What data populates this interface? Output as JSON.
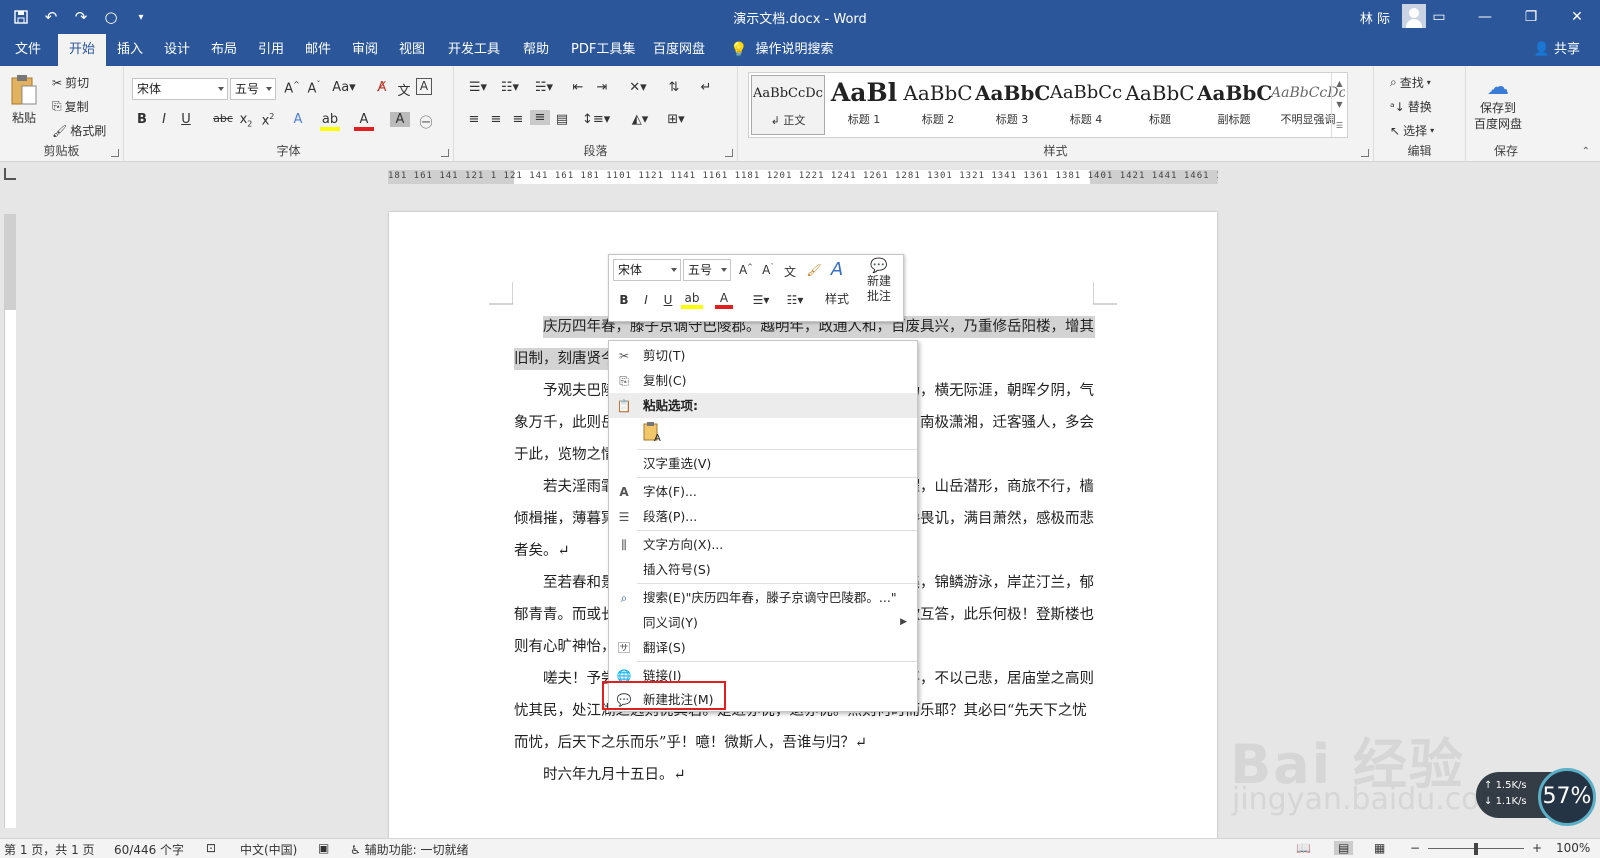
{
  "app": {
    "window_title": "演示文档.docx  -  Word",
    "user_name": "林 际",
    "share_label": "共享"
  },
  "tabs": [
    {
      "label": "文件"
    },
    {
      "label": "开始"
    },
    {
      "label": "插入"
    },
    {
      "label": "设计"
    },
    {
      "label": "布局"
    },
    {
      "label": "引用"
    },
    {
      "label": "邮件"
    },
    {
      "label": "审阅"
    },
    {
      "label": "视图"
    },
    {
      "label": "开发工具"
    },
    {
      "label": "帮助"
    },
    {
      "label": "PDF工具集"
    },
    {
      "label": "百度网盘"
    }
  ],
  "active_tab": "开始",
  "tell_me": "操作说明搜索",
  "ribbon": {
    "clipboard": {
      "label": "剪贴板",
      "paste": "粘贴",
      "cut": "剪切",
      "copy": "复制",
      "format_painter": "格式刷"
    },
    "font": {
      "label": "字体",
      "font_name": "宋体",
      "font_size": "五号"
    },
    "paragraph": {
      "label": "段落"
    },
    "styles": {
      "label": "样式",
      "items": [
        {
          "preview": "AaBbCcDc",
          "name": "正文"
        },
        {
          "preview": "AaBl",
          "name": "标题 1"
        },
        {
          "preview": "AaBbC",
          "name": "标题 2"
        },
        {
          "preview": "AaBbC",
          "name": "标题 3"
        },
        {
          "preview": "AaBbCc",
          "name": "标题 4"
        },
        {
          "preview": "AaBbC",
          "name": "标题"
        },
        {
          "preview": "AaBbC",
          "name": "副标题"
        },
        {
          "preview": "AaBbCcDc",
          "name": "不明显强调"
        }
      ]
    },
    "editing": {
      "label": "编辑",
      "find": "查找",
      "replace": "替换",
      "select": "选择"
    },
    "save": {
      "label": "保存",
      "save_to": "保存到",
      "baidu": "百度网盘"
    }
  },
  "ruler": {
    "numbers": "181 161 141 121  1 121 141 161 181 1101 1121 1141 1161 1181 1201 1221 1241 1261 1281 1301 1321 1341 1361 1381 1401 1421 1441 1461 148"
  },
  "document": {
    "lines": [
      "庆历四年春，滕子京谪守巴陵郡。越明年，政通人和，百废具兴，乃重修岳阳楼，增其",
      "旧制，刻唐贤今",
      "予观夫巴陵胜状，在洞庭一湖。衔远山，吞长江，浩浩汤汤，横无际涯，朝晖夕阴，气",
      "象万千，此则岳阳楼之大观也，前人之述备矣。然则北通巫峡，南极潇湘，迁客骚人，多会",
      "于此，览物之情",
      "若夫淫雨霏霏，连月不开，阴风怒号，浊浪排空，日星隐曜，山岳潜形，商旅不行，樯",
      "倾楫摧，薄暮冥冥，虎啸猿啼。登斯楼也，则有去国怀乡，忧谗畏讥，满目萧然，感极而悲",
      "者矣。↵",
      "至若春和景明，波澜不惊，上下天光，一碧万顷，沙鸥翔集，锦鳞游泳，岸芷汀兰，郁",
      "郁青青。而或长烟一空，皓月千里，浮光跃金，静影沉璧，渔歌互答，此乐何极！登斯楼也，",
      "则有心旷神怡，",
      "嗟夫！予尝求古仁人之心，或异二者之为，何哉？不以物喜，不以己悲，居庙堂之高则",
      "忧其民，处江湖之远则忧其君。是进亦忧，退亦忧。然则何时而乐耶？其必曰“先天下之忧",
      "而忧，后天下之乐而乐”乎！噫！微斯人，吾谁与归？↵",
      "时六年九月十五日。↵"
    ]
  },
  "minitoolbar": {
    "font_name": "宋体",
    "font_size": "五号",
    "styles": "样式",
    "new_comment_1": "新建",
    "new_comment_2": "批注"
  },
  "context_menu": {
    "items": [
      {
        "label": "剪切(T)",
        "icon": "scissors-icon"
      },
      {
        "label": "复制(C)",
        "icon": "copy-icon"
      },
      {
        "label": "粘贴选项:",
        "icon": "clipboard-icon"
      },
      {
        "label": "汉字重选(V)",
        "icon": ""
      },
      {
        "label": "字体(F)...",
        "icon": "font-icon"
      },
      {
        "label": "段落(P)...",
        "icon": "paragraph-icon"
      },
      {
        "label": "文字方向(X)...",
        "icon": "text-direction-icon"
      },
      {
        "label": "插入符号(S)",
        "icon": ""
      },
      {
        "label": "搜索(E)\"庆历四年春，滕子京谪守巴陵郡。...\"",
        "icon": "search-icon"
      },
      {
        "label": "同义词(Y)",
        "icon": ""
      },
      {
        "label": "翻译(S)",
        "icon": "translate-icon"
      },
      {
        "label": "链接(I)",
        "icon": "link-icon"
      },
      {
        "label": "新建批注(M)",
        "icon": "comment-icon"
      }
    ]
  },
  "statusbar": {
    "page": "第 1 页，共 1 页",
    "words": "60/446 个字",
    "language": "中文(中国)",
    "accessibility": "辅助功能: 一切就绪",
    "zoom": "100%"
  },
  "overlay": {
    "watermark_1": "Bai 经验",
    "watermark_2": "jingyan.baidu.com",
    "net_up": "1.5K/s",
    "net_down": "1.1K/s",
    "cpu": "57%"
  },
  "colors": {
    "accent": "#2b579a",
    "highlight_box": "#e02020"
  }
}
